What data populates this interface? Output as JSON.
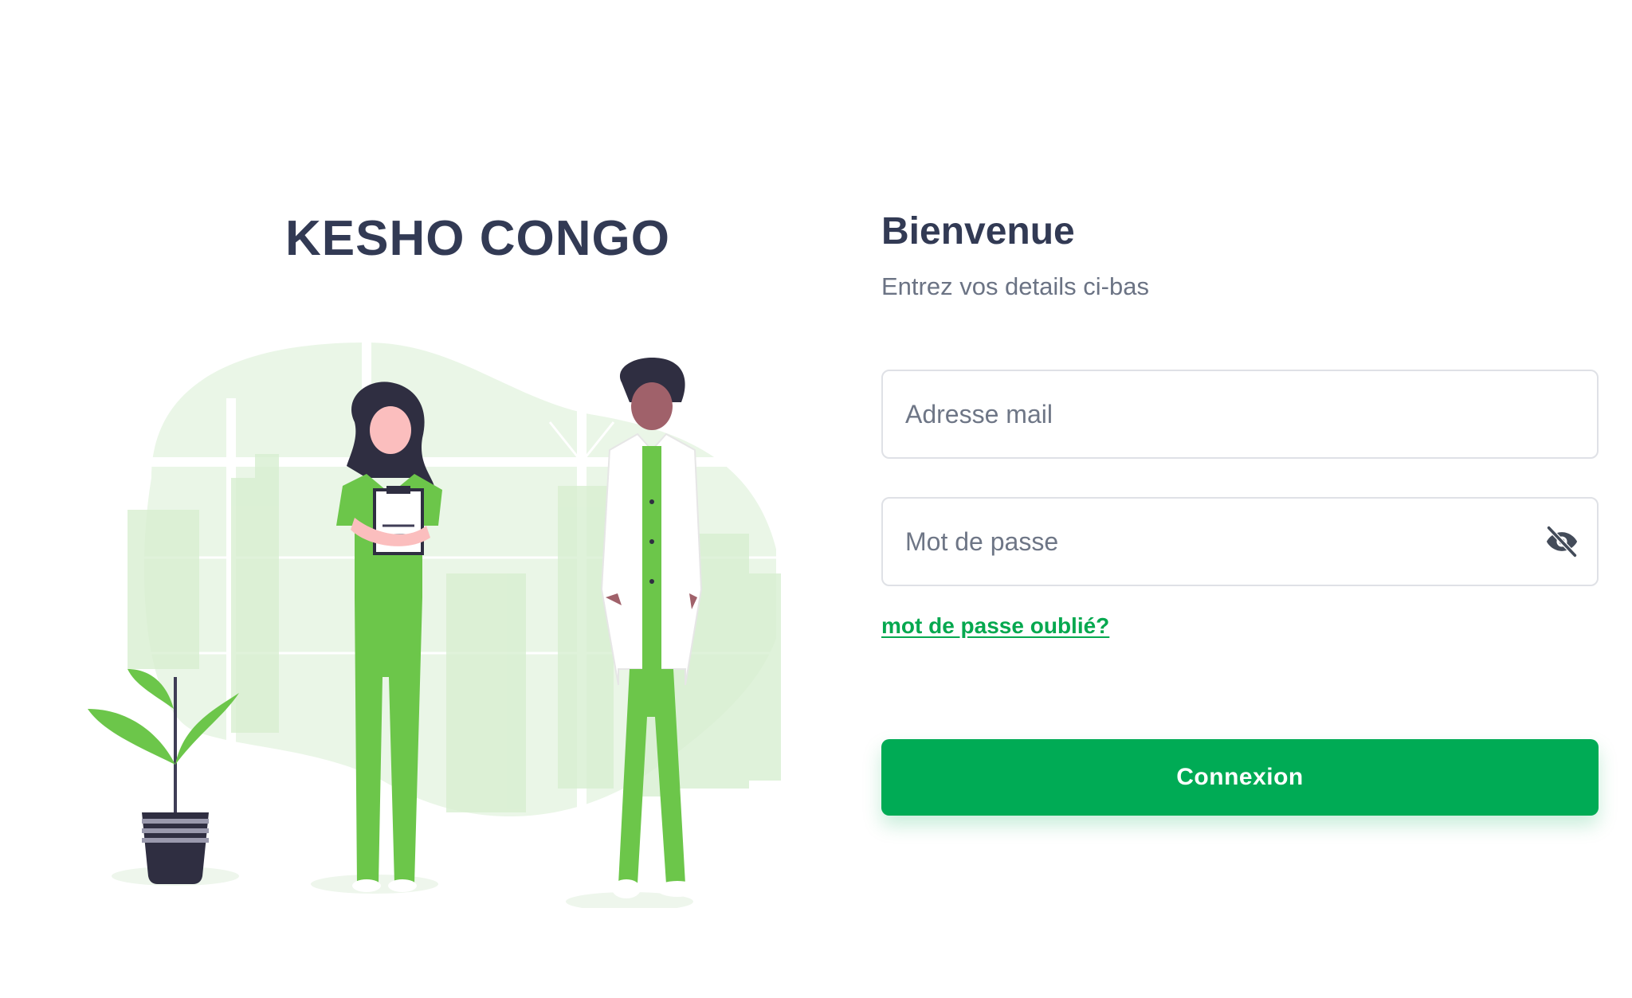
{
  "brand": {
    "title": "KESHO CONGO"
  },
  "login": {
    "title": "Bienvenue",
    "subtitle": "Entrez vos details ci-bas",
    "email_placeholder": "Adresse mail",
    "password_placeholder": "Mot de passe",
    "password_toggle_icon": "eye-slash-icon",
    "forgot_password_label": "mot de passe oublié?",
    "submit_label": "Connexion"
  },
  "colors": {
    "primary": "#00ab55",
    "heading": "#323a54",
    "muted_text": "#6b7384",
    "input_border": "#dfe1e6",
    "illustration_light_green": "#eaf6e7",
    "illustration_scrubs": "#6cc64a",
    "illustration_pot": "#2f2e41"
  }
}
